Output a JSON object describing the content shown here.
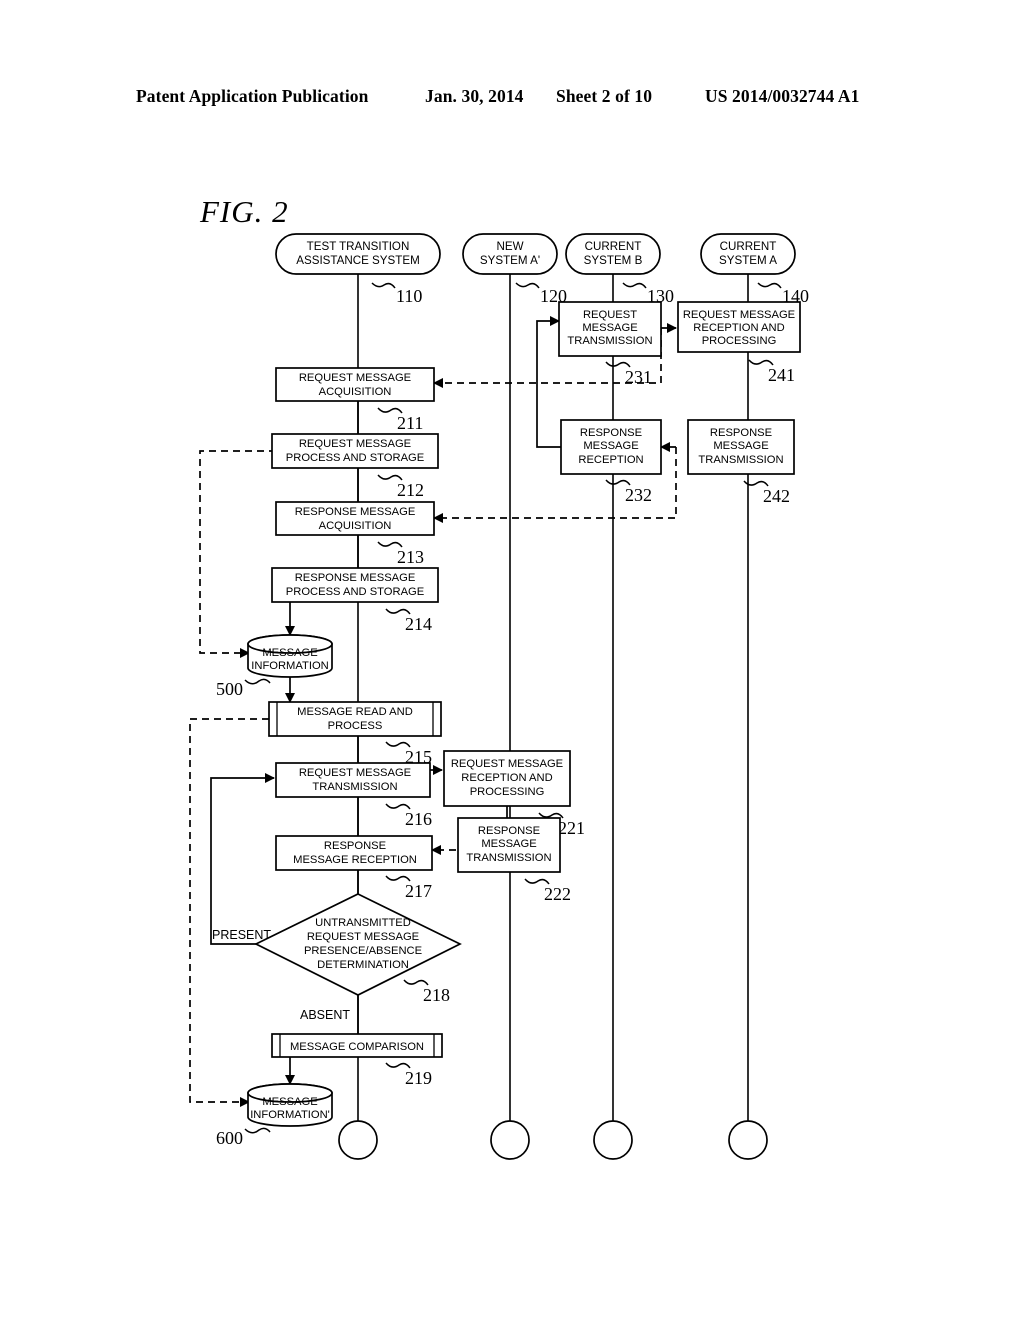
{
  "header": {
    "publication": "Patent Application Publication",
    "date": "Jan. 30, 2014",
    "sheet": "Sheet 2 of 10",
    "patent_number": "US 2014/0032744 A1"
  },
  "figure": {
    "label": "FIG. 2",
    "lifelines": [
      {
        "id": "110",
        "label_line1": "TEST TRANSITION",
        "label_line2": "ASSISTANCE SYSTEM",
        "ref": "110"
      },
      {
        "id": "120",
        "label_line1": "NEW",
        "label_line2": "SYSTEM A'",
        "ref": "120"
      },
      {
        "id": "130",
        "label_line1": "CURRENT",
        "label_line2": "SYSTEM B",
        "ref": "130"
      },
      {
        "id": "140",
        "label_line1": "CURRENT",
        "label_line2": "SYSTEM A",
        "ref": "140"
      }
    ],
    "nodes": [
      {
        "id": "211",
        "ref": "211",
        "lines": [
          "REQUEST MESSAGE",
          "ACQUISITION"
        ],
        "shape": "process"
      },
      {
        "id": "212",
        "ref": "212",
        "lines": [
          "REQUEST MESSAGE",
          "PROCESS AND STORAGE"
        ],
        "shape": "process"
      },
      {
        "id": "213",
        "ref": "213",
        "lines": [
          "RESPONSE MESSAGE",
          "ACQUISITION"
        ],
        "shape": "process"
      },
      {
        "id": "214",
        "ref": "214",
        "lines": [
          "RESPONSE MESSAGE",
          "PROCESS AND STORAGE"
        ],
        "shape": "process"
      },
      {
        "id": "500",
        "ref": "500",
        "lines": [
          "MESSAGE",
          "INFORMATION"
        ],
        "shape": "datastore"
      },
      {
        "id": "215",
        "ref": "215",
        "lines": [
          "MESSAGE READ AND",
          "PROCESS"
        ],
        "shape": "predefined"
      },
      {
        "id": "216",
        "ref": "216",
        "lines": [
          "REQUEST MESSAGE",
          "TRANSMISSION"
        ],
        "shape": "process"
      },
      {
        "id": "217",
        "ref": "217",
        "lines": [
          "RESPONSE",
          "MESSAGE RECEPTION"
        ],
        "shape": "process"
      },
      {
        "id": "218",
        "ref": "218",
        "lines": [
          "UNTRANSMITTED",
          "REQUEST MESSAGE",
          "PRESENCE/ABSENCE",
          "DETERMINATION"
        ],
        "shape": "decision"
      },
      {
        "id": "219",
        "ref": "219",
        "lines": [
          "MESSAGE COMPARISON"
        ],
        "shape": "predefined"
      },
      {
        "id": "600",
        "ref": "600",
        "lines": [
          "MESSAGE",
          "INFORMATION'"
        ],
        "shape": "datastore"
      },
      {
        "id": "221",
        "ref": "221",
        "lines": [
          "REQUEST MESSAGE",
          "RECEPTION AND",
          "PROCESSING"
        ],
        "shape": "process"
      },
      {
        "id": "222",
        "ref": "222",
        "lines": [
          "RESPONSE",
          "MESSAGE",
          "TRANSMISSION"
        ],
        "shape": "process"
      },
      {
        "id": "231",
        "ref": "231",
        "lines": [
          "REQUEST",
          "MESSAGE",
          "TRANSMISSION"
        ],
        "shape": "process"
      },
      {
        "id": "232",
        "ref": "232",
        "lines": [
          "RESPONSE",
          "MESSAGE",
          "RECEPTION"
        ],
        "shape": "process"
      },
      {
        "id": "241",
        "ref": "241",
        "lines": [
          "REQUEST MESSAGE",
          "RECEPTION AND",
          "PROCESSING"
        ],
        "shape": "process"
      },
      {
        "id": "242",
        "ref": "242",
        "lines": [
          "RESPONSE",
          "MESSAGE",
          "TRANSMISSION"
        ],
        "shape": "process"
      }
    ],
    "branch_labels": {
      "present": "PRESENT",
      "absent": "ABSENT"
    },
    "text": {
      "n110_l1": "TEST TRANSITION",
      "n110_l2": "ASSISTANCE SYSTEM",
      "n120_l1": "NEW",
      "n120_l2": "SYSTEM A'",
      "n130_l1": "CURRENT",
      "n130_l2": "SYSTEM B",
      "n140_l1": "CURRENT",
      "n140_l2": "SYSTEM A",
      "r110": "110",
      "r120": "120",
      "r130": "130",
      "r140": "140",
      "n211_l1": "REQUEST MESSAGE",
      "n211_l2": "ACQUISITION",
      "r211": "211",
      "n212_l1": "REQUEST MESSAGE",
      "n212_l2": "PROCESS AND STORAGE",
      "r212": "212",
      "n213_l1": "RESPONSE MESSAGE",
      "n213_l2": "ACQUISITION",
      "r213": "213",
      "n214_l1": "RESPONSE MESSAGE",
      "n214_l2": "PROCESS AND STORAGE",
      "r214": "214",
      "n500_l1": "MESSAGE",
      "n500_l2": "INFORMATION",
      "r500": "500",
      "n215_l1": "MESSAGE READ AND",
      "n215_l2": "PROCESS",
      "r215": "215",
      "n216_l1": "REQUEST MESSAGE",
      "n216_l2": "TRANSMISSION",
      "r216": "216",
      "n217_l1": "RESPONSE",
      "n217_l2": "MESSAGE RECEPTION",
      "r217": "217",
      "n218_l1": "UNTRANSMITTED",
      "n218_l2": "REQUEST MESSAGE",
      "n218_l3": "PRESENCE/ABSENCE",
      "n218_l4": "DETERMINATION",
      "r218": "218",
      "n219_l1": "MESSAGE COMPARISON",
      "r219": "219",
      "n600_l1": "MESSAGE",
      "n600_l2": "INFORMATION'",
      "r600": "600",
      "n221_l1": "REQUEST MESSAGE",
      "n221_l2": "RECEPTION AND",
      "n221_l3": "PROCESSING",
      "r221": "221",
      "n222_l1": "RESPONSE",
      "n222_l2": "MESSAGE",
      "n222_l3": "TRANSMISSION",
      "r222": "222",
      "n231_l1": "REQUEST",
      "n231_l2": "MESSAGE",
      "n231_l3": "TRANSMISSION",
      "r231": "231",
      "n232_l1": "RESPONSE",
      "n232_l2": "MESSAGE",
      "n232_l3": "RECEPTION",
      "r232": "232",
      "n241_l1": "REQUEST MESSAGE",
      "n241_l2": "RECEPTION AND",
      "n241_l3": "PROCESSING",
      "r241": "241",
      "n242_l1": "RESPONSE",
      "n242_l2": "MESSAGE",
      "n242_l3": "TRANSMISSION",
      "r242": "242",
      "present": "PRESENT",
      "absent": "ABSENT",
      "fig_label": "FIG. 2"
    }
  }
}
